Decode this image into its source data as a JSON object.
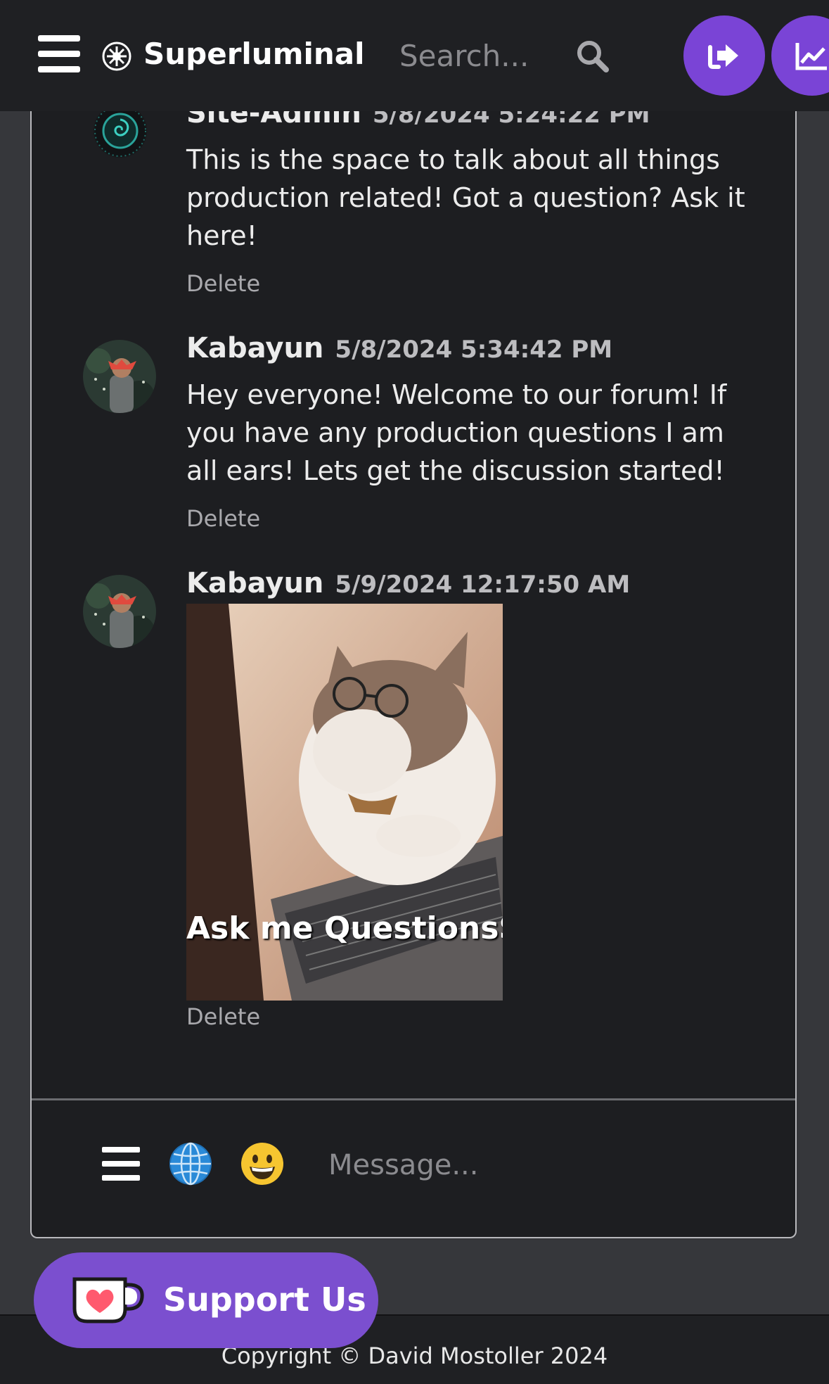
{
  "header": {
    "brand": "Superluminal",
    "search_placeholder": "Search...",
    "icons": {
      "menu": "hamburger-menu-icon",
      "logo": "starburst-logo-icon",
      "search": "magnifier-icon",
      "logout": "sign-out-icon",
      "stats": "line-chart-icon"
    },
    "accent_color": "#7a44d6"
  },
  "messages": [
    {
      "author": "Site-Admin",
      "timestamp": "5/8/2024 5:24:22 PM",
      "text": "This is the space to talk about all things production related! Got a question? Ask it here!",
      "delete_label": "Delete"
    },
    {
      "author": "Kabayun",
      "timestamp": "5/8/2024 5:34:42 PM",
      "text": "Hey everyone! Welcome to our forum! If you have any production questions I am all ears! Lets get the discussion started!",
      "delete_label": "Delete"
    },
    {
      "author": "Kabayun",
      "timestamp": "5/9/2024 12:17:50 AM",
      "image_caption": "Ask me QuestionsS!!",
      "delete_label": "Delete"
    }
  ],
  "composer": {
    "placeholder": "Message...",
    "icons": [
      "composer-menu-icon",
      "globe-icon",
      "grinning-face-icon"
    ]
  },
  "support_button": {
    "label": "Support Us",
    "icon": "ko-fi-cup-heart-icon"
  },
  "footer": {
    "copyright": "Copyright © David Mostoller 2024"
  }
}
